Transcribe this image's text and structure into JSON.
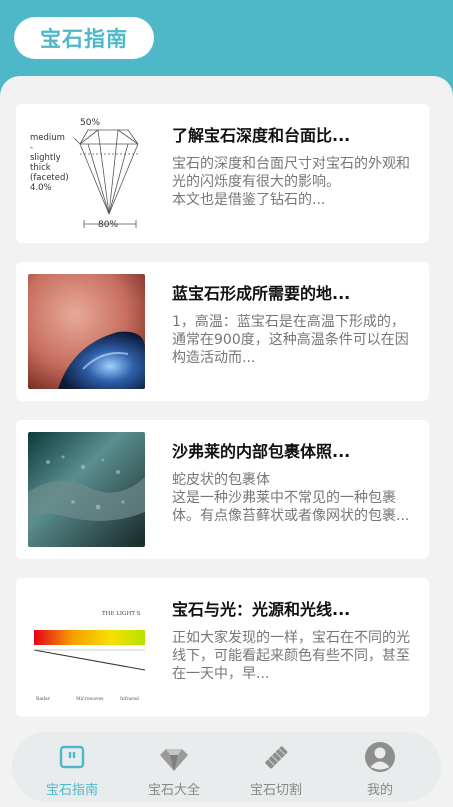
{
  "header": {
    "title": "宝石指南"
  },
  "articles": [
    {
      "title": "了解宝石深度和台面比...",
      "excerpt": "宝石的深度和台面尺寸对宝石的外观和光的闪烁度有很大的影响。\n本文也是借鉴了钻石的...",
      "figure": {
        "top_label": "50%",
        "bottom_label": "80%",
        "side_label_lines": [
          "medium",
          "-",
          "slightly",
          "thick",
          "(faceted)",
          "4.0%"
        ]
      }
    },
    {
      "title": "蓝宝石形成所需要的地...",
      "excerpt": "1，高温：蓝宝石是在高温下形成的，通常在900度，这种高温条件可以在因构造活动而..."
    },
    {
      "title": "沙弗莱的内部包裹体照...",
      "excerpt": "蛇皮状的包裹体\n这是一种沙弗莱中不常见的一种包裹体。有点像苔藓状或者像网状的包裹..."
    },
    {
      "title": "宝石与光：光源和光线...",
      "excerpt": "正如大家发现的一样，宝石在不同的光线下，可能看起来颜色有些不同，甚至在一天中，早...",
      "figure": {
        "heading": "THE LIGHT S",
        "axis_labels": [
          "Radar",
          "Microwaves",
          "Infrared"
        ]
      }
    }
  ],
  "tabs": [
    {
      "label": "宝石指南",
      "icon": "book-icon",
      "active": true
    },
    {
      "label": "宝石大全",
      "icon": "diamond-icon",
      "active": false
    },
    {
      "label": "宝石切割",
      "icon": "cutting-tool-icon",
      "active": false
    },
    {
      "label": "我的",
      "icon": "user-icon",
      "active": false
    }
  ],
  "colors": {
    "accent": "#4fb8c8",
    "inactive": "#888888"
  }
}
